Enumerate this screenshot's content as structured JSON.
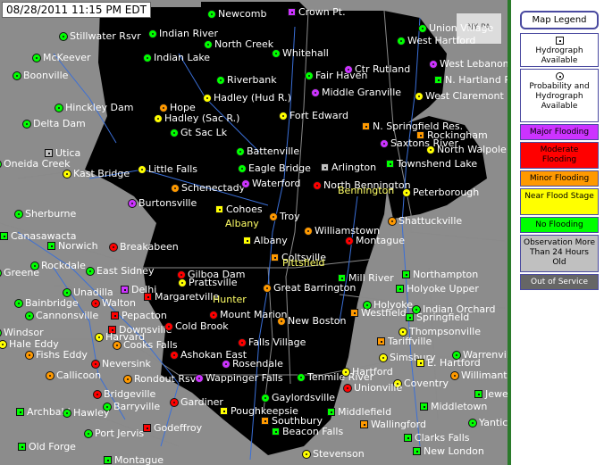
{
  "timestamp": "08/28/2011 11:15 PM EDT",
  "logo_text": "NY PA",
  "legend": {
    "title": "Map Legend",
    "items": [
      {
        "label": "Hydrograph Available",
        "symbol": "square",
        "bg": "#ffffff"
      },
      {
        "label": "Probability and Hydrograph Available",
        "symbol": "circle",
        "bg": "#ffffff"
      },
      {
        "label": "Major Flooding",
        "bg": "#cc33ff"
      },
      {
        "label": "Moderate Flooding",
        "bg": "#ff0000"
      },
      {
        "label": "Minor Flooding",
        "bg": "#ff9900"
      },
      {
        "label": "Near Flood Stage",
        "bg": "#ffff00"
      },
      {
        "label": "No Flooding",
        "bg": "#00ff00"
      },
      {
        "label": "Observation More Than 24 Hours Old",
        "bg": "#c0c0c0"
      },
      {
        "label": "Out of Service",
        "bg": "#666666"
      }
    ]
  },
  "status_colors": {
    "major": "#cc33ff",
    "moderate": "#ff0000",
    "minor": "#ff9900",
    "near": "#ffff00",
    "none": "#00ff00",
    "old": "#c0c0c0",
    "oos": "#666666"
  },
  "gauges": [
    {
      "name": "Newcomb",
      "status": "none",
      "shape": "circle"
    },
    {
      "name": "Crown Pt.",
      "status": "major",
      "shape": "square"
    },
    {
      "name": "Union Village",
      "status": "none",
      "shape": "circle"
    },
    {
      "name": "Stillwater Rsvr",
      "status": "none",
      "shape": "circle"
    },
    {
      "name": "Indian River",
      "status": "none",
      "shape": "circle"
    },
    {
      "name": "North Creek",
      "status": "none",
      "shape": "circle"
    },
    {
      "name": "West Hartford",
      "status": "none",
      "shape": "circle"
    },
    {
      "name": "McKeever",
      "status": "none",
      "shape": "circle"
    },
    {
      "name": "Indian Lake",
      "status": "none",
      "shape": "circle"
    },
    {
      "name": "Whitehall",
      "status": "none",
      "shape": "circle"
    },
    {
      "name": "West Lebanon",
      "status": "major",
      "shape": "circle"
    },
    {
      "name": "Boonville",
      "status": "none",
      "shape": "circle"
    },
    {
      "name": "Riverbank",
      "status": "none",
      "shape": "circle"
    },
    {
      "name": "Fair Haven",
      "status": "none",
      "shape": "circle"
    },
    {
      "name": "Ctr Rutland",
      "status": "major",
      "shape": "circle"
    },
    {
      "name": "N. Hartland Res.",
      "status": "none",
      "shape": "square"
    },
    {
      "name": "Hadley (Hud R.)",
      "status": "near",
      "shape": "circle"
    },
    {
      "name": "Middle Granville",
      "status": "major",
      "shape": "circle"
    },
    {
      "name": "Hinckley Dam",
      "status": "none",
      "shape": "circle"
    },
    {
      "name": "West Claremont",
      "status": "near",
      "shape": "circle"
    },
    {
      "name": "Hope",
      "status": "minor",
      "shape": "circle"
    },
    {
      "name": "Hadley (Sac R.)",
      "status": "near",
      "shape": "circle"
    },
    {
      "name": "Fort Edward",
      "status": "near",
      "shape": "circle"
    },
    {
      "name": "Delta Dam",
      "status": "none",
      "shape": "circle"
    },
    {
      "name": "Gt Sac Lk",
      "status": "none",
      "shape": "circle"
    },
    {
      "name": "N. Springfield Res.",
      "status": "minor",
      "shape": "square"
    },
    {
      "name": "Rockingham",
      "status": "minor",
      "shape": "square"
    },
    {
      "name": "Utica",
      "status": "old",
      "shape": "square"
    },
    {
      "name": "Battenville",
      "status": "none",
      "shape": "circle"
    },
    {
      "name": "Saxtons River",
      "status": "major",
      "shape": "circle"
    },
    {
      "name": "North Walpole",
      "status": "near",
      "shape": "circle"
    },
    {
      "name": "Oneida Creek",
      "status": "none",
      "shape": "circle"
    },
    {
      "name": "Arlington",
      "status": "old",
      "shape": "square"
    },
    {
      "name": "Townshend Lake",
      "status": "none",
      "shape": "square"
    },
    {
      "name": "Kast Bridge",
      "status": "near",
      "shape": "circle"
    },
    {
      "name": "Little Falls",
      "status": "near",
      "shape": "circle"
    },
    {
      "name": "Eagle Bridge",
      "status": "none",
      "shape": "circle"
    },
    {
      "name": "Schenectady",
      "status": "minor",
      "shape": "circle"
    },
    {
      "name": "North Bennington",
      "status": "moderate",
      "shape": "circle"
    },
    {
      "name": "Waterford",
      "status": "major",
      "shape": "circle"
    },
    {
      "name": "Peterborough",
      "status": "near",
      "shape": "circle"
    },
    {
      "name": "Burtonsville",
      "status": "major",
      "shape": "circle"
    },
    {
      "name": "Cohoes",
      "status": "near",
      "shape": "square"
    },
    {
      "name": "Troy",
      "status": "minor",
      "shape": "circle"
    },
    {
      "name": "Sherburne",
      "status": "none",
      "shape": "circle"
    },
    {
      "name": "Shattuckville",
      "status": "minor",
      "shape": "circle"
    },
    {
      "name": "Albany",
      "status": "near",
      "shape": "square"
    },
    {
      "name": "Williamstown",
      "status": "minor",
      "shape": "circle"
    },
    {
      "name": "Canasawacta",
      "status": "none",
      "shape": "square"
    },
    {
      "name": "Montague",
      "status": "moderate",
      "shape": "circle"
    },
    {
      "name": "Norwich",
      "status": "none",
      "shape": "square"
    },
    {
      "name": "Breakabeen",
      "status": "moderate",
      "shape": "circle"
    },
    {
      "name": "Coltsville",
      "status": "minor",
      "shape": "square"
    },
    {
      "name": "Rockdale",
      "status": "none",
      "shape": "circle"
    },
    {
      "name": "Gilboa Dam",
      "status": "moderate",
      "shape": "circle"
    },
    {
      "name": "East Sidney",
      "status": "none",
      "shape": "circle"
    },
    {
      "name": "Greene",
      "status": "none",
      "shape": "circle"
    },
    {
      "name": "Prattsville",
      "status": "near",
      "shape": "circle"
    },
    {
      "name": "Northampton",
      "status": "none",
      "shape": "square"
    },
    {
      "name": "Mill River",
      "status": "none",
      "shape": "square"
    },
    {
      "name": "Unadilla",
      "status": "none",
      "shape": "circle"
    },
    {
      "name": "Great Barrington",
      "status": "minor",
      "shape": "circle"
    },
    {
      "name": "Holyoke Upper",
      "status": "none",
      "shape": "square"
    },
    {
      "name": "Delhi",
      "status": "major",
      "shape": "square"
    },
    {
      "name": "Margaretville",
      "status": "moderate",
      "shape": "square"
    },
    {
      "name": "Bainbridge",
      "status": "none",
      "shape": "circle"
    },
    {
      "name": "Walton",
      "status": "moderate",
      "shape": "circle"
    },
    {
      "name": "Holyoke",
      "status": "none",
      "shape": "circle"
    },
    {
      "name": "Indian Orchard",
      "status": "none",
      "shape": "circle"
    },
    {
      "name": "Cannonsville",
      "status": "none",
      "shape": "circle"
    },
    {
      "name": "Pepacton",
      "status": "moderate",
      "shape": "square"
    },
    {
      "name": "Mount Marion",
      "status": "moderate",
      "shape": "circle"
    },
    {
      "name": "Westfield",
      "status": "minor",
      "shape": "square"
    },
    {
      "name": "Springfield",
      "status": "none",
      "shape": "square"
    },
    {
      "name": "Downsville",
      "status": "moderate",
      "shape": "square"
    },
    {
      "name": "Cold Brook",
      "status": "moderate",
      "shape": "circle"
    },
    {
      "name": "New Boston",
      "status": "minor",
      "shape": "circle"
    },
    {
      "name": "Windsor",
      "status": "none",
      "shape": "circle"
    },
    {
      "name": "Harvard",
      "status": "near",
      "shape": "circle"
    },
    {
      "name": "Thompsonville",
      "status": "near",
      "shape": "circle"
    },
    {
      "name": "Hale Eddy",
      "status": "near",
      "shape": "circle"
    },
    {
      "name": "Cooks Falls",
      "status": "minor",
      "shape": "circle"
    },
    {
      "name": "Falls Village",
      "status": "moderate",
      "shape": "circle"
    },
    {
      "name": "Fishs Eddy",
      "status": "minor",
      "shape": "circle"
    },
    {
      "name": "Ashokan East",
      "status": "moderate",
      "shape": "circle"
    },
    {
      "name": "Tariffville",
      "status": "minor",
      "shape": "square"
    },
    {
      "name": "Simsbury",
      "status": "near",
      "shape": "circle"
    },
    {
      "name": "Warrenville",
      "status": "none",
      "shape": "circle"
    },
    {
      "name": "Rosendale",
      "status": "major",
      "shape": "circle"
    },
    {
      "name": "Neversink",
      "status": "moderate",
      "shape": "circle"
    },
    {
      "name": "E. Hartford",
      "status": "near",
      "shape": "square"
    },
    {
      "name": "Willimantic",
      "status": "minor",
      "shape": "circle"
    },
    {
      "name": "Callicoon",
      "status": "minor",
      "shape": "circle"
    },
    {
      "name": "Rondout Rsvr",
      "status": "minor",
      "shape": "circle"
    },
    {
      "name": "Wappinger Falls",
      "status": "major",
      "shape": "circle"
    },
    {
      "name": "Tenmile River",
      "status": "none",
      "shape": "circle"
    },
    {
      "name": "Hartford",
      "status": "near",
      "shape": "circle"
    },
    {
      "name": "Coventry",
      "status": "near",
      "shape": "circle"
    },
    {
      "name": "Jewett City",
      "status": "none",
      "shape": "square"
    },
    {
      "name": "Bridgeville",
      "status": "moderate",
      "shape": "circle"
    },
    {
      "name": "Unionville",
      "status": "moderate",
      "shape": "circle"
    },
    {
      "name": "Gaylordsville",
      "status": "none",
      "shape": "circle"
    },
    {
      "name": "Barryville",
      "status": "none",
      "shape": "circle"
    },
    {
      "name": "Gardiner",
      "status": "moderate",
      "shape": "circle"
    },
    {
      "name": "Poughkeepsie",
      "status": "near",
      "shape": "square"
    },
    {
      "name": "Middletown",
      "status": "none",
      "shape": "square"
    },
    {
      "name": "Archbald",
      "status": "none",
      "shape": "square"
    },
    {
      "name": "Hawley",
      "status": "none",
      "shape": "circle"
    },
    {
      "name": "Middlefield",
      "status": "none",
      "shape": "square"
    },
    {
      "name": "Yantic",
      "status": "none",
      "shape": "circle"
    },
    {
      "name": "Southbury",
      "status": "minor",
      "shape": "square"
    },
    {
      "name": "Godeffroy",
      "status": "moderate",
      "shape": "square"
    },
    {
      "name": "Wallingford",
      "status": "minor",
      "shape": "square"
    },
    {
      "name": "Port Jervis",
      "status": "none",
      "shape": "circle"
    },
    {
      "name": "Beacon Falls",
      "status": "none",
      "shape": "square"
    },
    {
      "name": "Clarks Falls",
      "status": "none",
      "shape": "square"
    },
    {
      "name": "Old Forge",
      "status": "none",
      "shape": "square"
    },
    {
      "name": "Montague",
      "status": "none",
      "shape": "square"
    },
    {
      "name": "Stevenson",
      "status": "near",
      "shape": "circle"
    },
    {
      "name": "New London",
      "status": "none",
      "shape": "square"
    }
  ],
  "cities": [
    "Albany",
    "Bennington",
    "Pittsfield",
    "Hunter"
  ]
}
